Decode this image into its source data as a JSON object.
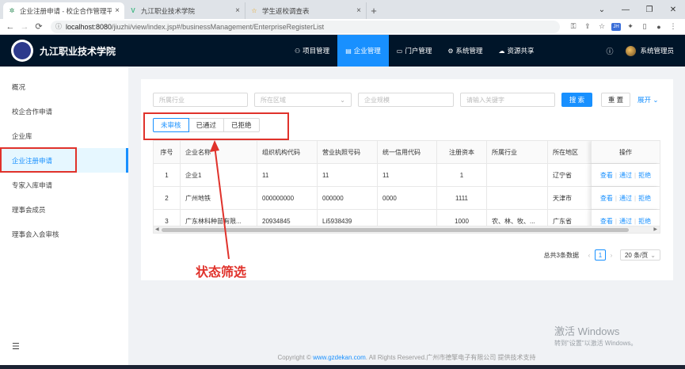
{
  "browser": {
    "tabs": [
      {
        "title": "企业注册申请 - 校企合作管理平台",
        "icon": "gear-icon"
      },
      {
        "title": "九江职业技术学院",
        "icon": "vue-icon"
      },
      {
        "title": "学生返校调查表",
        "icon": "star-icon"
      }
    ],
    "url_host": "localhost:8080",
    "url_path": "/jiuzhi/view/index.jsp#/businessManagement/EnterpriseRegisterList"
  },
  "header": {
    "title": "九江职业技术学院",
    "nav": [
      {
        "label": "项目管理",
        "icon": "project-icon"
      },
      {
        "label": "企业管理",
        "icon": "enterprise-icon",
        "active": true
      },
      {
        "label": "门户管理",
        "icon": "monitor-icon"
      },
      {
        "label": "系统管理",
        "icon": "gear-icon"
      },
      {
        "label": "资源共享",
        "icon": "cloud-icon"
      }
    ],
    "help_icon": "question-icon",
    "user": "系统管理员"
  },
  "sidebar": {
    "items": [
      {
        "label": "概况"
      },
      {
        "label": "校企合作申请"
      },
      {
        "label": "企业库"
      },
      {
        "label": "企业注册申请",
        "active": true
      },
      {
        "label": "专家入库申请"
      },
      {
        "label": "理事会成员"
      },
      {
        "label": "理事会入会审核"
      }
    ]
  },
  "filters": {
    "industry_placeholder": "所属行业",
    "region_placeholder": "所在区域",
    "scale_placeholder": "企业规模",
    "keyword_placeholder": "请输入关键字",
    "search_label": "搜 索",
    "reset_label": "重 置",
    "expand_label": "展开"
  },
  "status_tabs": [
    "未审核",
    "已通过",
    "已拒绝"
  ],
  "table": {
    "columns": [
      "序号",
      "企业名称",
      "组织机构代码",
      "营业执照号码",
      "统一信用代码",
      "注册资本",
      "所属行业",
      "所在地区",
      "操作"
    ],
    "rows": [
      [
        "1",
        "企业1",
        "11",
        "11",
        "11",
        "1",
        "",
        "辽宁省"
      ],
      [
        "2",
        "广州地铁",
        "000000000",
        "000000",
        "0000",
        "1111",
        "",
        "天津市"
      ],
      [
        "3",
        "广东林科种苗有限...",
        "20934845",
        "Li5938439",
        "",
        "1000",
        "农、林、牧、...",
        "广东省"
      ]
    ],
    "actions": [
      "查看",
      "通过",
      "拒绝"
    ]
  },
  "pagination": {
    "total": "总共3条数据",
    "page": "1",
    "size": "20 条/页"
  },
  "annotation": "状态筛选",
  "footer": {
    "prefix": "Copyright © ",
    "link": "www.gzdekan.com",
    "suffix": ". All Rights Reserved.广州市德擎电子有限公司 提供技术支持"
  },
  "watermark": {
    "line1": "激活 Windows",
    "line2": "转到\"设置\"以激活 Windows。"
  },
  "colors": {
    "primary": "#1890ff",
    "header_bg": "#001529",
    "annotation_red": "#e0322b"
  }
}
